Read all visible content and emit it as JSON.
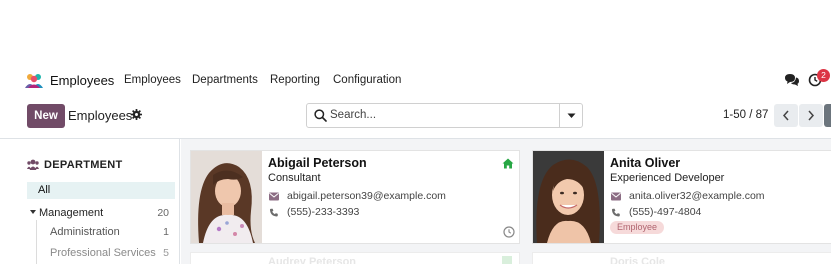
{
  "app": {
    "name": "Employees"
  },
  "nav": {
    "menu": [
      "Employees",
      "Departments",
      "Reporting",
      "Configuration"
    ],
    "activity_count": "2"
  },
  "control": {
    "new_label": "New",
    "title": "Employees",
    "search_placeholder": "Search...",
    "pager_value": "1-50 / 87"
  },
  "sidebar": {
    "header": "DEPARTMENT",
    "all_label": "All",
    "items": [
      {
        "label": "Management",
        "count": "20"
      },
      {
        "label": "Administration",
        "count": "1"
      },
      {
        "label": "Professional Services",
        "count": "5"
      }
    ]
  },
  "cards": [
    {
      "name": "Abigail Peterson",
      "job": "Consultant",
      "email": "abigail.peterson39@example.com",
      "phone": "(555)-233-3393"
    },
    {
      "name": "Anita Oliver",
      "job": "Experienced Developer",
      "email": "anita.oliver32@example.com",
      "phone": "(555)-497-4804",
      "tag": "Employee"
    }
  ],
  "ghost_cards": [
    "Audrey Peterson",
    "Doris Cole"
  ],
  "colors": {
    "brand": "#714b67",
    "email_icon": "#8c6d84",
    "presence_home": "#28a745",
    "tag_bg": "#f6dada",
    "badge": "#dc3545"
  }
}
